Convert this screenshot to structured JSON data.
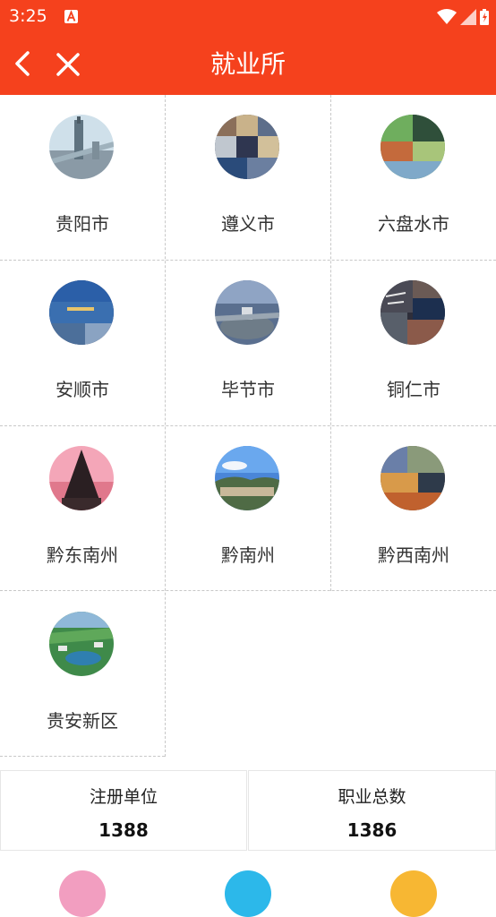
{
  "status_bar": {
    "time": "3:25"
  },
  "title_bar": {
    "title": "就业所"
  },
  "cities": [
    {
      "name": "贵阳市"
    },
    {
      "name": "遵义市"
    },
    {
      "name": "六盘水市"
    },
    {
      "name": "安顺市"
    },
    {
      "name": "毕节市"
    },
    {
      "name": "铜仁市"
    },
    {
      "name": "黔东南州"
    },
    {
      "name": "黔南州"
    },
    {
      "name": "黔西南州"
    },
    {
      "name": "贵安新区"
    }
  ],
  "stats": [
    {
      "title": "注册单位",
      "value": "1388"
    },
    {
      "title": "职业总数",
      "value": "1386"
    }
  ],
  "colors": {
    "accent": "#f5411d",
    "bubble_pink": "#f29ec0",
    "bubble_blue": "#2cb8ea",
    "bubble_yellow": "#f7b733"
  }
}
